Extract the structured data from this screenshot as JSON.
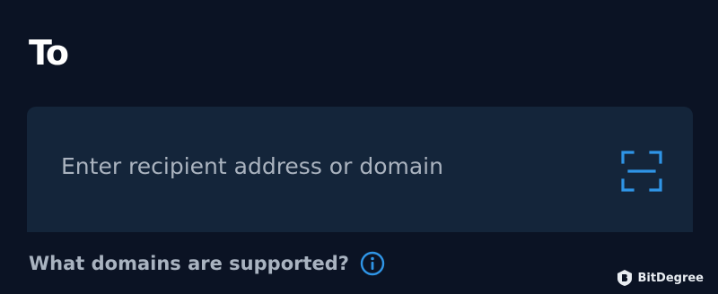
{
  "section": {
    "title": "To"
  },
  "recipient": {
    "value": "",
    "placeholder": "Enter recipient address or domain",
    "scan_icon": "scan-qr-icon"
  },
  "help": {
    "text": "What domains are supported?",
    "icon": "info-icon"
  },
  "watermark": {
    "text": "BitDegree",
    "icon": "bitdegree-logo"
  },
  "colors": {
    "background": "#0b1324",
    "field_background": "#14253a",
    "accent": "#2f95e6",
    "heading": "#ffffff",
    "muted_text": "#a9b3c0"
  }
}
